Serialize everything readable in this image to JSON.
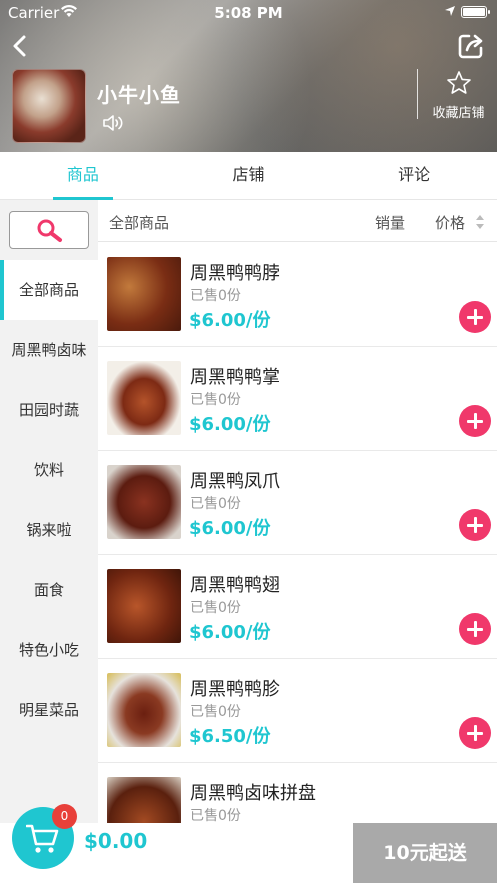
{
  "status_bar": {
    "carrier": "Carrier",
    "time": "5:08 PM"
  },
  "shop": {
    "name": "小牛小鱼",
    "favorite_label": "收藏店铺"
  },
  "tabs": [
    {
      "label": "商品",
      "active": true
    },
    {
      "label": "店铺",
      "active": false
    },
    {
      "label": "评论",
      "active": false
    }
  ],
  "sidebar": {
    "categories": [
      {
        "label": "全部商品",
        "active": true
      },
      {
        "label": "周黑鸭卤味"
      },
      {
        "label": "田园时蔬"
      },
      {
        "label": "饮料"
      },
      {
        "label": "锅来啦"
      },
      {
        "label": "面食"
      },
      {
        "label": "特色小吃"
      },
      {
        "label": "明星菜品"
      }
    ]
  },
  "list_header": {
    "all": "全部商品",
    "sales": "销量",
    "price": "价格"
  },
  "products": [
    {
      "name": "周黑鸭鸭脖",
      "sold": "已售0份",
      "price": "$6.00/份"
    },
    {
      "name": "周黑鸭鸭掌",
      "sold": "已售0份",
      "price": "$6.00/份"
    },
    {
      "name": "周黑鸭凤爪",
      "sold": "已售0份",
      "price": "$6.00/份"
    },
    {
      "name": "周黑鸭鸭翅",
      "sold": "已售0份",
      "price": "$6.00/份"
    },
    {
      "name": "周黑鸭鸭胗",
      "sold": "已售0份",
      "price": "$6.50/份"
    },
    {
      "name": "周黑鸭卤味拼盘",
      "sold": "已售0份",
      "price": ""
    }
  ],
  "cart": {
    "badge": "0",
    "total": "$0.00",
    "min_order_label": "10元起送"
  },
  "colors": {
    "accent": "#1fc6d0",
    "add_button": "#f0386b",
    "badge": "#e8403a",
    "checkout_disabled": "#a9a9a9"
  }
}
